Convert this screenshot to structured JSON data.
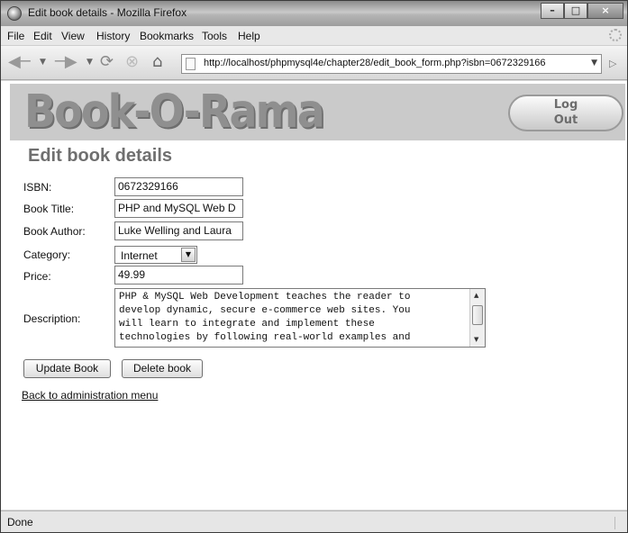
{
  "window": {
    "title": "Edit book details - Mozilla Firefox"
  },
  "menubar": {
    "items": [
      "File",
      "Edit",
      "View",
      "History",
      "Bookmarks",
      "Tools",
      "Help"
    ]
  },
  "navbar": {
    "url": "http://localhost/phpmysql4e/chapter28/edit_book_form.php?isbn=0672329166"
  },
  "banner": {
    "logo": "Book-O-Rama",
    "logout_line1": "Log",
    "logout_line2": "Out"
  },
  "page": {
    "title": "Edit book details"
  },
  "form": {
    "isbn_label": "ISBN:",
    "isbn_value": "0672329166",
    "title_label": "Book Title:",
    "title_value": "PHP and MySQL Web D",
    "author_label": "Book Author:",
    "author_value": "Luke Welling and Laura",
    "category_label": "Category:",
    "category_value": "Internet",
    "price_label": "Price:",
    "price_value": "49.99",
    "description_label": "Description:",
    "description_value": "PHP & MySQL Web Development teaches the reader to\ndevelop dynamic, secure e-commerce web sites. You\nwill learn to integrate and implement these\ntechnologies by following real-world examples and",
    "update_button": "Update Book",
    "delete_button": "Delete book"
  },
  "links": {
    "back": "Back to administration menu"
  },
  "statusbar": {
    "text": "Done"
  }
}
